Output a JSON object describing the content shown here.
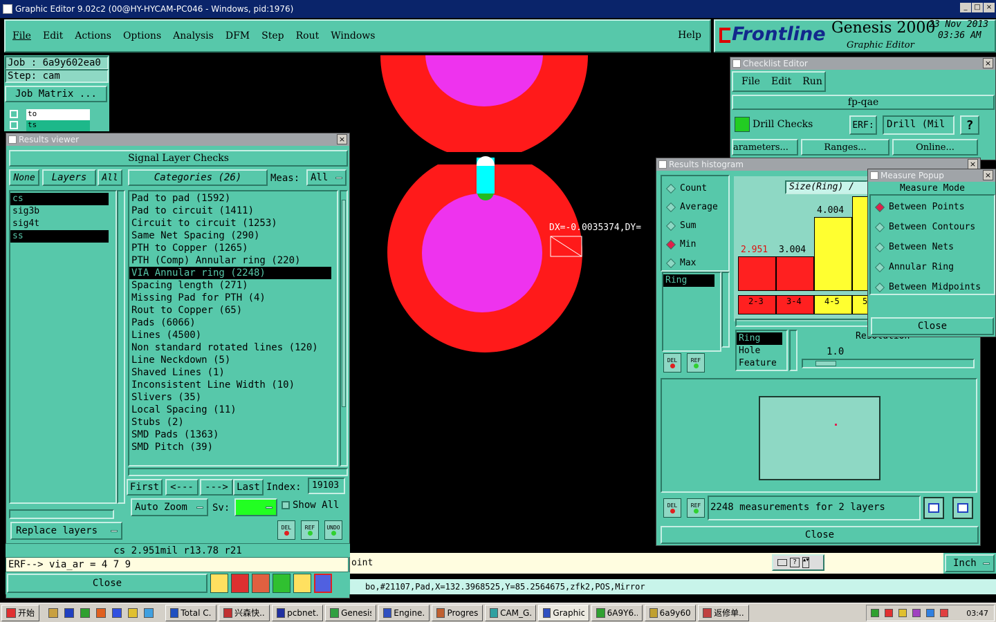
{
  "window": {
    "title": "Graphic Editor 9.02c2 (00@HY-HYCAM-PC046 - Windows, pid:1976)"
  },
  "menu": [
    "File",
    "Edit",
    "Actions",
    "Options",
    "Analysis",
    "DFM",
    "Step",
    "Rout",
    "Windows"
  ],
  "help_label": "Help",
  "brand": {
    "logo": "Frontline",
    "product": "Genesis 2000",
    "subtitle": "Graphic Editor",
    "date": "23 Nov 2013",
    "time": "03:36 AM"
  },
  "job": {
    "job_line": "Job : 6a9y602ea0",
    "step_line": "Step: cam",
    "matrix_button": "Job Matrix ...",
    "layer_rows": [
      "to",
      "ts"
    ]
  },
  "canvas": {
    "measure_text": "DX=-0.0035374,DY="
  },
  "results_viewer": {
    "title": "Results viewer",
    "header": "Signal Layer Checks",
    "none": "None",
    "layers": "Layers",
    "all": "All",
    "categories": "Categories (26)",
    "meas_label": "Meas:",
    "meas_value": "All",
    "layer_list": [
      "cs",
      "sig3b",
      "sig4t",
      "ss"
    ],
    "category_list": [
      "Pad to pad (1592)",
      "Pad to circuit (1411)",
      "Circuit to circuit (1253)",
      "Same Net Spacing (290)",
      "PTH to Copper (1265)",
      "PTH (Comp) Annular ring (220)",
      "VIA Annular ring (2248)",
      "Spacing length (271)",
      "Missing Pad for PTH (4)",
      "Rout to Copper (65)",
      "Pads (6066)",
      "Lines (4500)",
      "Non standard rotated lines (120)",
      "Line Neckdown (5)",
      "Shaved Lines (1)",
      "Inconsistent Line Width (10)",
      "Slivers (35)",
      "Local Spacing (11)",
      "Stubs (2)",
      "SMD Pads (1363)",
      "SMD Pitch (39)"
    ],
    "nav": {
      "first": "First",
      "prev": "<---",
      "next": "--->",
      "last": "Last",
      "index_label": "Index:",
      "index_value": "19103"
    },
    "auto_zoom": "Auto Zoom",
    "sv_label": "Sv:",
    "show_all": "Show All",
    "replace_layers": "Replace layers",
    "del": "DEL",
    "ref": "REF",
    "undo": "UNDO"
  },
  "status": {
    "measure_line": "cs 2.951mil   r13.78   r21",
    "erf_line": "ERF--> via_ar = 4 7 9",
    "close": "Close",
    "point_text": "oint",
    "info_line": "bo,#21107,Pad,X=132.3968525,Y=85.2564675,zfk2,POS,Mirror",
    "units": "Inch"
  },
  "checklist": {
    "title": "Checklist Editor",
    "menu": [
      "File",
      "Edit",
      "Run"
    ],
    "name": "fp-qae",
    "check": "Drill Checks",
    "erf_label": "ERF:",
    "erf_value": "Drill (Mil",
    "help": "?",
    "buttons": [
      "arameters...",
      "Ranges...",
      "Online..."
    ]
  },
  "histogram": {
    "title": "Results histogram",
    "stats": [
      {
        "label": "Count",
        "on": false
      },
      {
        "label": "Average",
        "on": false
      },
      {
        "label": "Sum",
        "on": false
      },
      {
        "label": "Min",
        "on": true
      },
      {
        "label": "Max",
        "on": false
      }
    ],
    "list": [
      "Ring"
    ],
    "measure": "Size(Ring) /",
    "bars": [
      {
        "value": "2.951",
        "range": "2-3",
        "color": "#ff2020",
        "fill": 0.35
      },
      {
        "value": "3.004",
        "range": "3-4",
        "color": "#ff2020",
        "fill": 0.35
      },
      {
        "value": "4.004",
        "range": "4-5",
        "color": "#ffff30",
        "fill": 0.74
      },
      {
        "value": "",
        "range": "5",
        "color": "#ffff30",
        "fill": 0.95
      }
    ],
    "types": [
      "Ring",
      "Hole",
      "Feature"
    ],
    "resolution_label": "Resolution",
    "resolution_value": "1.0",
    "summary": "2248 measurements for 2 layers",
    "close": "Close"
  },
  "measure_popup": {
    "title": "Measure Popup",
    "mode_label": "Measure Mode",
    "modes": [
      {
        "label": "Between Points",
        "on": true
      },
      {
        "label": "Between Contours",
        "on": false
      },
      {
        "label": "Between Nets",
        "on": false
      },
      {
        "label": "Annular Ring",
        "on": false
      },
      {
        "label": "Between Midpoints",
        "on": false
      }
    ],
    "close": "Close"
  },
  "taskbar": {
    "start": "开始",
    "items": [
      "Total C...",
      "兴森快...",
      "pcbnet...",
      "Genesis",
      "Engine...",
      "Progress",
      "CAM_G...",
      "Graphic...",
      "6A9Y6...",
      "6a9y60...",
      "返修单..."
    ],
    "clock": "03:47"
  },
  "colors": {
    "teal": "#57c8aa",
    "pad_red": "#ff1a1a",
    "pad_magenta": "#ee33ee"
  }
}
